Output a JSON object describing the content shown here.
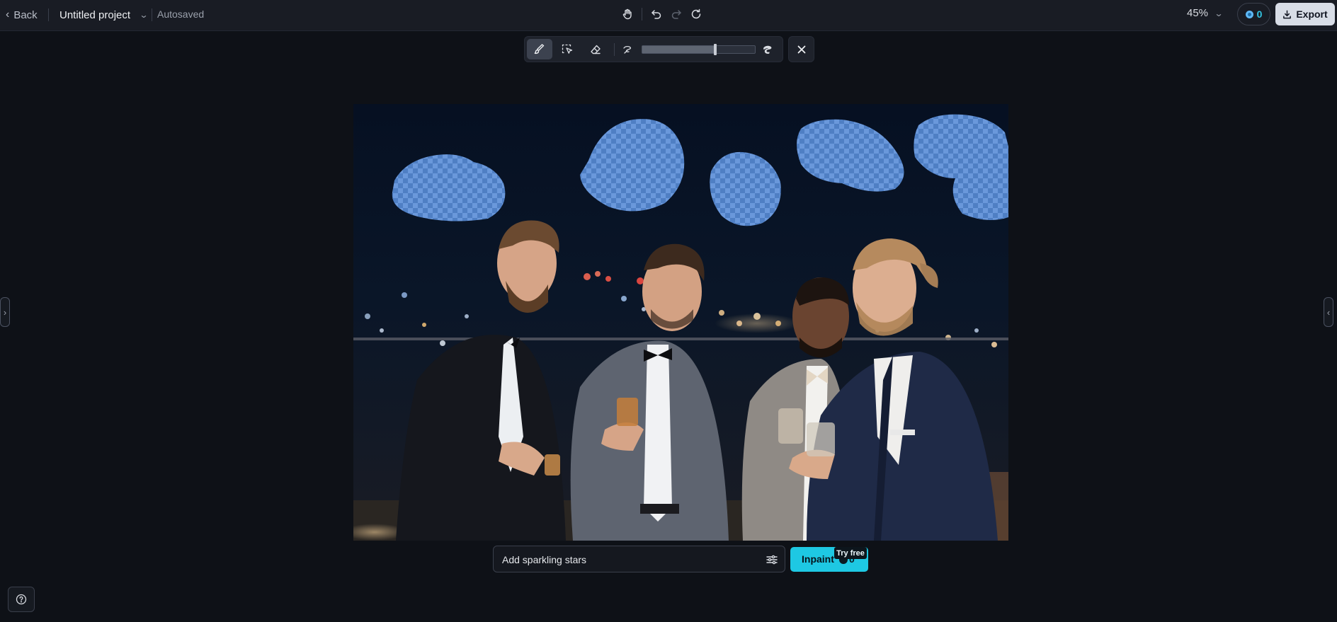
{
  "topbar": {
    "back_label": "Back",
    "project_name": "Untitled project",
    "save_status": "Autosaved",
    "zoom_level": "45%",
    "credits_count": "0",
    "export_label": "Export"
  },
  "center_tools": [
    "hand-icon",
    "undo-icon",
    "redo-icon",
    "reset-icon"
  ],
  "brush_toolbar": {
    "tools": [
      "brush-icon",
      "select-icon",
      "eraser-icon"
    ],
    "brush_size_fraction": 0.65
  },
  "prompt": {
    "value": "Add sparkling stars",
    "placeholder": ""
  },
  "inpaint": {
    "label": "Inpaint",
    "cost": "0",
    "badge": "Try free"
  },
  "colors": {
    "background": "#0e1117",
    "topbar": "#191c24",
    "accent": "#1ec8e3",
    "mask": "#5b8fd9"
  }
}
